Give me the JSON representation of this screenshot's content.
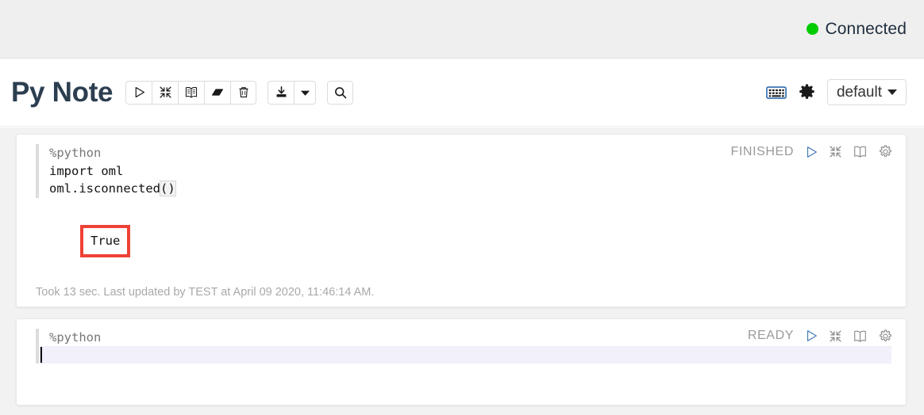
{
  "topbar": {
    "connection_status": "Connected",
    "connection_color": "#00cc00"
  },
  "header": {
    "title": "Py Note",
    "toolbar_group_1": [
      {
        "name": "run-all-paragraphs",
        "icon": "play-icon",
        "label": "Run all paragraphs"
      },
      {
        "name": "toggle-all-collapse",
        "icon": "collapse-icon",
        "label": "Show/hide the output"
      },
      {
        "name": "toggle-all-editors",
        "icon": "book-icon",
        "label": "Show/hide the code"
      },
      {
        "name": "clear-all-output",
        "icon": "eraser-icon",
        "label": "Clear output"
      },
      {
        "name": "delete-note",
        "icon": "trash-icon",
        "label": "Remove the notebook"
      }
    ],
    "toolbar_group_2": [
      {
        "name": "export-note",
        "icon": "download-icon",
        "label": "Export the notebook"
      },
      {
        "name": "export-dropdown",
        "icon": "caret-down-icon",
        "label": "Export options"
      }
    ],
    "toolbar_group_3": [
      {
        "name": "search-code",
        "icon": "search-icon",
        "label": "Search code"
      }
    ],
    "shortcut_icon": "keyboard-icon",
    "settings_icon": "gear-icon",
    "interpreter_label": "default"
  },
  "paragraphs": [
    {
      "status": "FINISHED",
      "controls": [
        {
          "name": "run-paragraph",
          "icon": "play-icon"
        },
        {
          "name": "toggle-output",
          "icon": "collapse-icon"
        },
        {
          "name": "toggle-editor",
          "icon": "book-icon"
        },
        {
          "name": "paragraph-settings",
          "icon": "gear-icon"
        }
      ],
      "code": [
        {
          "text": "%python",
          "kind": "magic"
        },
        {
          "text": "import oml",
          "kind": "code"
        },
        {
          "text": "oml.isconnected",
          "kind": "code",
          "paren": "()"
        }
      ],
      "result": "True",
      "result_highlighted": true,
      "highlight_color": "#ef4136",
      "footer": "Took 13 sec. Last updated by TEST at April 09 2020, 11:46:14 AM."
    },
    {
      "status": "READY",
      "controls": [
        {
          "name": "run-paragraph",
          "icon": "play-icon"
        },
        {
          "name": "toggle-output",
          "icon": "collapse-icon"
        },
        {
          "name": "toggle-editor",
          "icon": "book-icon"
        },
        {
          "name": "paragraph-settings",
          "icon": "gear-icon"
        }
      ],
      "code": [
        {
          "text": "%python",
          "kind": "magic"
        }
      ],
      "active_line": true,
      "result": "",
      "result_highlighted": false,
      "footer": ""
    }
  ]
}
